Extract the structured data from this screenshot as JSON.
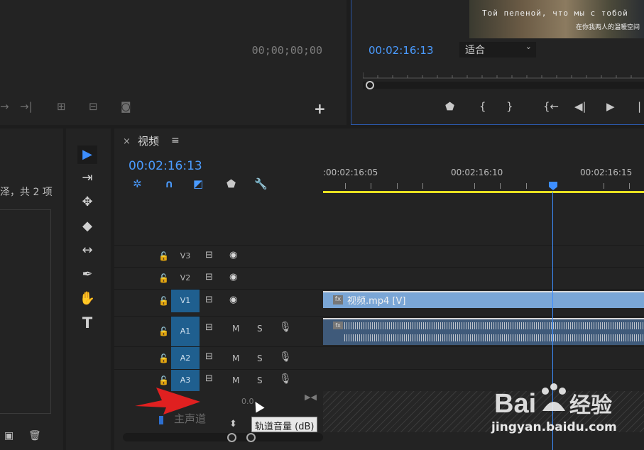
{
  "source_monitor": {
    "timecode": "00;00;00;00",
    "controls": [
      "→",
      "→}",
      "insert-icon",
      "overlay-icon",
      "camera-icon"
    ]
  },
  "program_monitor": {
    "subtitle_line1": "Той пеленой, что мы с тобой",
    "subtitle_line2": "在你我两人的温暖空间",
    "timecode": "00:02:16:13",
    "fit_select": {
      "value": "适合"
    },
    "add_button": "+"
  },
  "project_panel": {
    "item_count": "泽，共 2 项"
  },
  "tools": [
    {
      "name": "selection-tool",
      "glyph": "▶"
    },
    {
      "name": "track-select-tool",
      "glyph": "⇥"
    },
    {
      "name": "ripple-edit-tool",
      "glyph": "✥"
    },
    {
      "name": "razor-tool",
      "glyph": "◆"
    },
    {
      "name": "slip-tool",
      "glyph": "↔"
    },
    {
      "name": "pen-tool",
      "glyph": "✒"
    },
    {
      "name": "hand-tool",
      "glyph": "✋"
    },
    {
      "name": "type-tool",
      "glyph": "T"
    }
  ],
  "timeline": {
    "close": "×",
    "title": "视频",
    "menu": "≡",
    "timecode": "00:02:16:13",
    "ruler": [
      "00:02:16:05",
      "00:02:16:10",
      "00:02:16:15"
    ],
    "ruler_start": ":00:02:16:05",
    "tracks": [
      {
        "name": "V3",
        "type": "video"
      },
      {
        "name": "V2",
        "type": "video"
      },
      {
        "name": "V1",
        "type": "video"
      },
      {
        "name": "A1",
        "type": "audio"
      },
      {
        "name": "A2",
        "type": "audio"
      },
      {
        "name": "A3",
        "type": "audio"
      }
    ],
    "mute": "M",
    "solo": "S",
    "video_clip": {
      "fx": "fx",
      "name": "视频.mp4 [V]"
    },
    "audio_clip": {
      "fx": "fx"
    },
    "master": {
      "label": "主声道",
      "value": "0.0"
    },
    "tooltip": "轨道音量 (dB)"
  },
  "watermark": {
    "logo_text": "Bai经验",
    "url": "jingyan.baidu.com"
  },
  "colors": {
    "accent_blue": "#3d8eff",
    "timecode_blue": "#4a9bff",
    "work_area_yellow": "#e8e020",
    "clip_video": "#7aa6d6",
    "clip_audio": "#3f5a7a",
    "arrow_red": "#e02020"
  }
}
